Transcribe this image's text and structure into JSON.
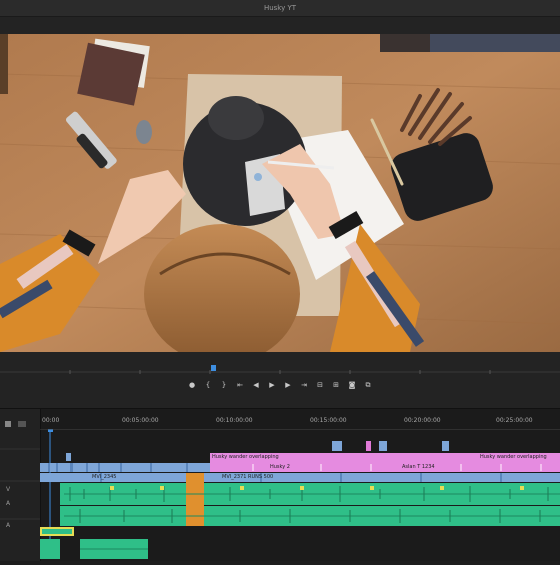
{
  "window": {
    "title": "Husky YT"
  },
  "timeline": {
    "start_timecode": "00:00",
    "ticks": [
      "00:05:00:00",
      "00:10:00:00",
      "00:15:00:00",
      "00:20:00:00",
      "00:25:00:00"
    ],
    "video_clips": [
      {
        "label": "Husky wander overlapping"
      },
      {
        "label": "Husky wander overlapping"
      },
      {
        "label": "Aslan T 1234"
      }
    ],
    "audio_clips": [
      {
        "label": "MVI_2345"
      },
      {
        "label": "MVI_2371 RUNS 500"
      },
      {
        "label": "Husky 2"
      }
    ]
  },
  "transport": {
    "buttons": [
      "marker",
      "in",
      "out",
      "go-in",
      "step-back",
      "play",
      "step-forward",
      "go-out",
      "insert",
      "overwrite",
      "export-frame",
      "button-editor"
    ]
  }
}
